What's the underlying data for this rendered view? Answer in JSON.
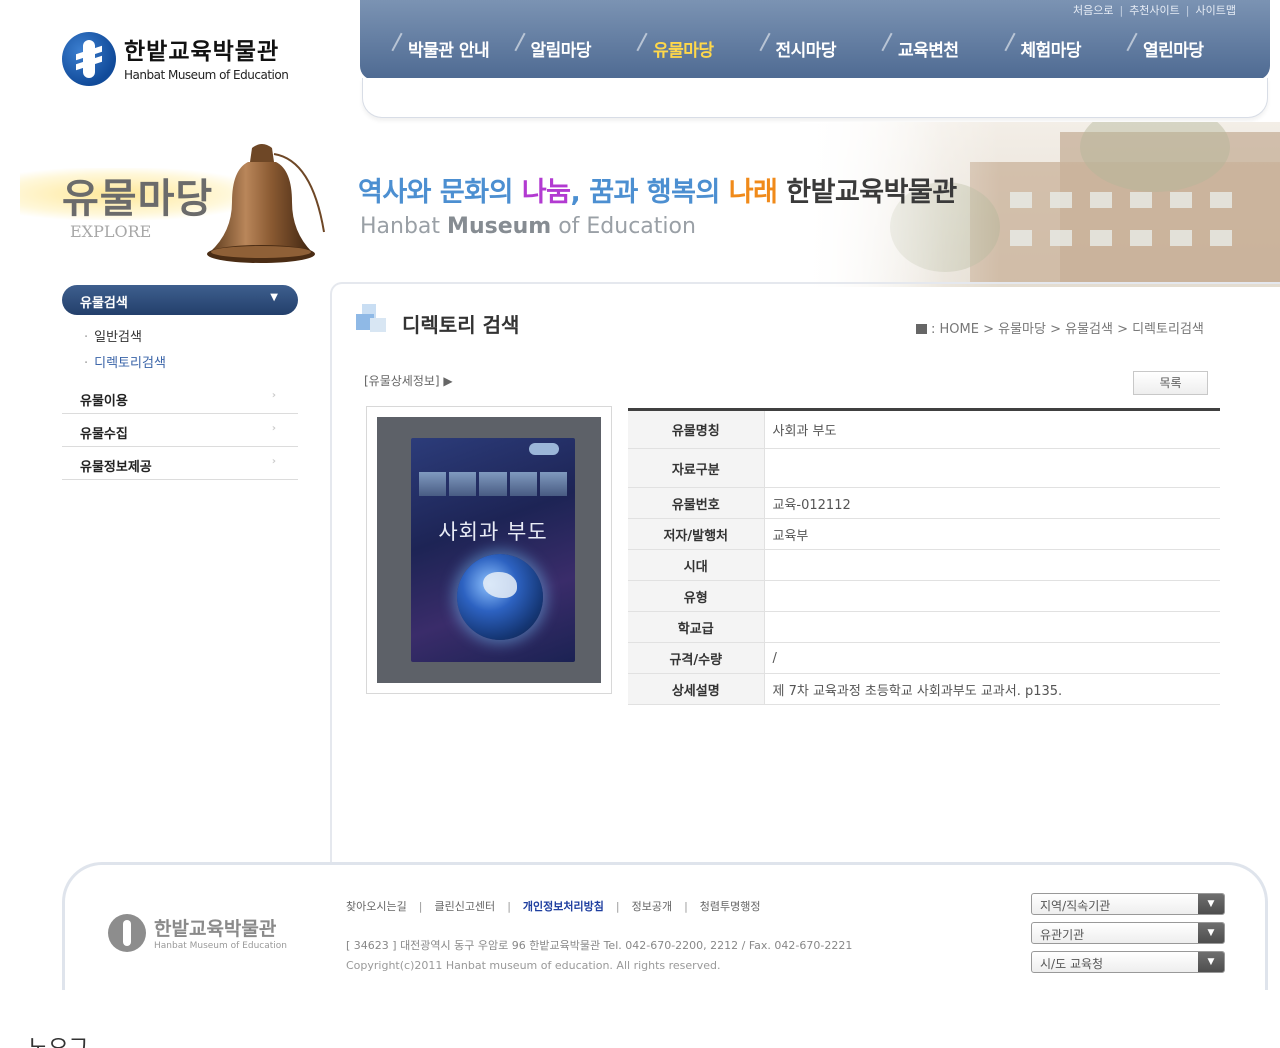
{
  "header": {
    "logo_title": "한밭교육박물관",
    "logo_subtitle": "Hanbat Museum of Education",
    "utility_links": [
      "처음으로",
      "추천사이트",
      "사이트맵"
    ],
    "menu": [
      "박물관 안내",
      "알림마당",
      "유물마당",
      "전시마당",
      "교육변천",
      "체험마당",
      "열린마당"
    ],
    "active_menu": "유물마당"
  },
  "banner": {
    "section_title": "유물마당",
    "section_subtitle": "EXPLORE",
    "slogan_part1": "역사와 문화의 ",
    "slogan_part2": "나눔",
    "slogan_part3": ", 꿈과 행복의 ",
    "slogan_part4": "나래",
    "slogan_part5": " 한밭교육박물관",
    "slogan_en_1": "Hanbat ",
    "slogan_en_2": "Museum",
    "slogan_en_3": " of Education"
  },
  "lnb": {
    "current": "유물검색",
    "sub_items": [
      "일반검색",
      "디렉토리검색"
    ],
    "items": [
      "유물이용",
      "유물수집",
      "유물정보제공"
    ]
  },
  "content": {
    "page_title": "디렉토리 검색",
    "breadcrumb": ": HOME > 유물마당 > 유물검색 > 디렉토리검색",
    "detail_label": "[유물상세정보] ▶",
    "list_button": "목록",
    "book_cover_title": "사회과 부도",
    "fields": [
      {
        "label": "유물명칭",
        "value": "사회과 부도"
      },
      {
        "label": "자료구분",
        "value": ""
      },
      {
        "label": "유물번호",
        "value": "교육-012112"
      },
      {
        "label": "저자/발행처",
        "value": "교육부"
      },
      {
        "label": "시대",
        "value": ""
      },
      {
        "label": "유형",
        "value": ""
      },
      {
        "label": "학교급",
        "value": ""
      },
      {
        "label": "규격/수량",
        "value": "/"
      },
      {
        "label": "상세설명",
        "value": "제 7차 교육과정 초등학교 사회과부도 교과서. p135."
      }
    ]
  },
  "footer": {
    "logo_title": "한밭교육박물관",
    "logo_subtitle": "Hanbat Museum of Education",
    "links": [
      "찾아오시는길",
      "클린신고센터",
      "개인정보처리방침",
      "정보공개",
      "청렴투명행정"
    ],
    "highlight_link": "개인정보처리방침",
    "address": "[ 34623 ] 대전광역시 동구 우암로 96 한밭교육박물관   Tel. 042-670-2200, 2212 / Fax. 042-670-2221",
    "copyright": "Copyright(c)2011 Hanbat museum of education. All rights reserved.",
    "selects": [
      "지역/직속기관",
      "유관기관",
      "시/도 교육청"
    ]
  },
  "trailing_text": "노오그",
  "colors": {
    "nav_bar": "#5a7498",
    "active_menu": "#ffd84a",
    "lnb_current": "#2d4a78",
    "slogan_blue": "#4c8fd1",
    "slogan_purple": "#b23ad1",
    "slogan_orange": "#f08a1a"
  }
}
